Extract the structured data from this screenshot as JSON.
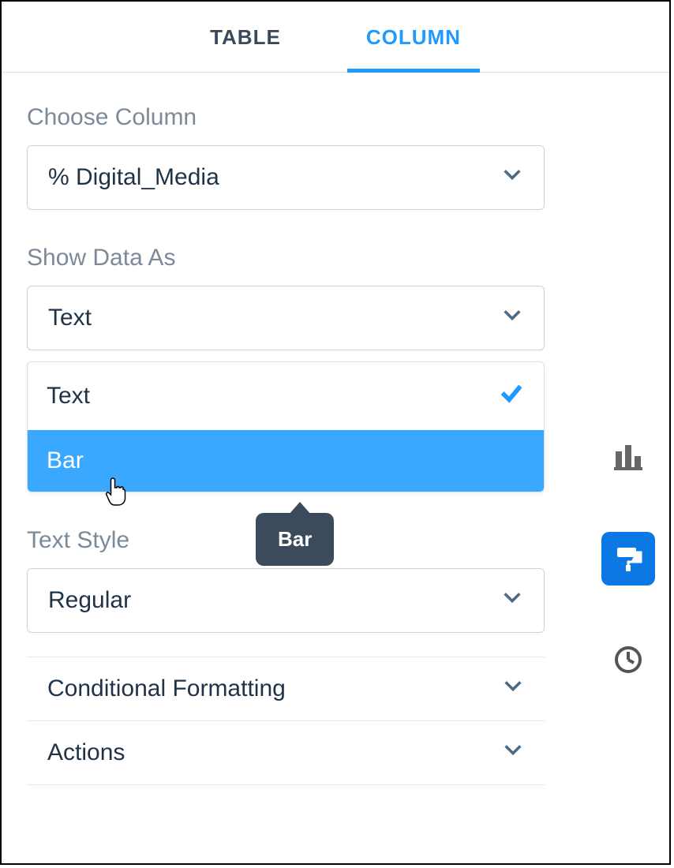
{
  "tabs": {
    "table": "TABLE",
    "column": "COLUMN"
  },
  "labels": {
    "choose_column": "Choose Column",
    "show_data_as": "Show Data As",
    "text_style": "Text Style"
  },
  "selects": {
    "column": "% Digital_Media",
    "show_data_as": "Text",
    "text_style": "Regular"
  },
  "options": {
    "show_data_as": {
      "text": "Text",
      "bar": "Bar"
    }
  },
  "sections": {
    "conditional_formatting": "Conditional Formatting",
    "actions": "Actions"
  },
  "tooltip": {
    "bar": "Bar"
  },
  "rail": {
    "bars": "chart-icon",
    "paint": "paint-roller-icon",
    "clock": "history-icon"
  }
}
